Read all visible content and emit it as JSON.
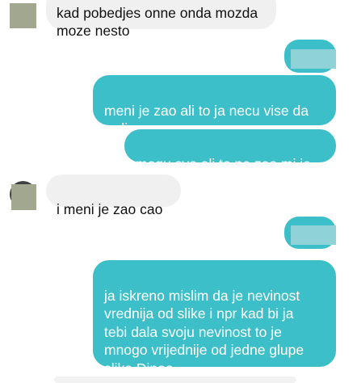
{
  "chat": {
    "messages": [
      {
        "direction": "incoming",
        "text": "kad pobedjes onne onda mozda\nmoze nesto"
      },
      {
        "direction": "outgoing",
        "text": "",
        "redacted": true
      },
      {
        "direction": "outgoing",
        "text": "meni je zao ali to ja necu vise da\nradim"
      },
      {
        "direction": "outgoing",
        "text": "mogu sve ali to ne zao mi je"
      },
      {
        "direction": "incoming",
        "text": "i meni je zao cao"
      },
      {
        "direction": "outgoing",
        "text": "",
        "redacted": true
      },
      {
        "direction": "outgoing",
        "text": "ja iskreno mislim da je nevinost\nvrednija od slike i npr kad bi ja\ntebi dala svoju nevinost to je\nmnogo vrijednije od jedne glupe\nslike Dinoo"
      }
    ]
  },
  "colors": {
    "outgoing_bubble": "#3cbfc9",
    "incoming_bubble": "#f0f0f0",
    "avatar_redaction": "#a2a890"
  }
}
